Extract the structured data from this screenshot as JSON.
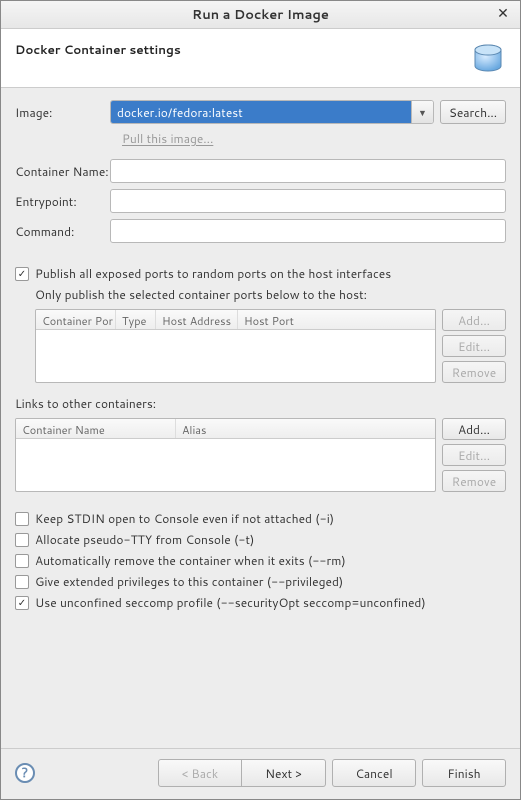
{
  "window": {
    "title": "Run a Docker Image"
  },
  "banner": {
    "title": "Docker Container settings"
  },
  "labels": {
    "image": "Image:",
    "container_name": "Container Name:",
    "entrypoint": "Entrypoint:",
    "command": "Command:"
  },
  "image": {
    "value": "docker.io/fedora:latest",
    "search": "Search...",
    "pull_link": "Pull this image..."
  },
  "fields": {
    "container_name": "",
    "entrypoint": "",
    "command": ""
  },
  "ports": {
    "publish_all_label": "Publish all exposed ports to random ports on the host interfaces",
    "publish_all_checked": true,
    "selected_label": "Only publish the selected container ports below to the host:",
    "columns": {
      "container_port": "Container Por",
      "type": "Type",
      "host_address": "Host Address",
      "host_port": "Host Port"
    },
    "buttons": {
      "add": "Add...",
      "edit": "Edit...",
      "remove": "Remove"
    }
  },
  "links": {
    "section_label": "Links to other containers:",
    "columns": {
      "container_name": "Container Name",
      "alias": "Alias"
    },
    "buttons": {
      "add": "Add...",
      "edit": "Edit...",
      "remove": "Remove"
    }
  },
  "options": {
    "stdin": {
      "label": "Keep STDIN open to Console even if not attached (-i)",
      "checked": false
    },
    "tty": {
      "label": "Allocate pseudo-TTY from Console (-t)",
      "checked": false
    },
    "rm": {
      "label": "Automatically remove the container when it exits (--rm)",
      "checked": false
    },
    "privileged": {
      "label": "Give extended privileges to this container (--privileged)",
      "checked": false
    },
    "seccomp": {
      "label": "Use unconfined seccomp profile (--securityOpt seccomp=unconfined)",
      "checked": true
    }
  },
  "footer": {
    "back": "< Back",
    "next": "Next >",
    "cancel": "Cancel",
    "finish": "Finish"
  }
}
